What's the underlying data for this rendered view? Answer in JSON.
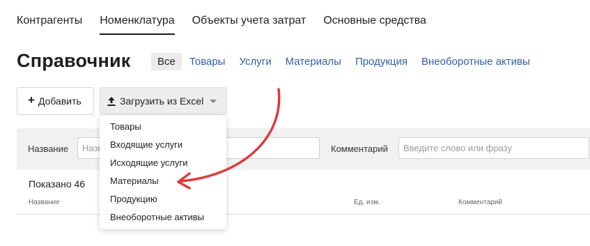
{
  "top_tabs": [
    {
      "label": "Контрагенты",
      "active": false
    },
    {
      "label": "Номенклатура",
      "active": true
    },
    {
      "label": "Объекты учета затрат",
      "active": false
    },
    {
      "label": "Основные средства",
      "active": false
    }
  ],
  "page_title": "Справочник",
  "filter_tabs": [
    {
      "label": "Все",
      "active": true
    },
    {
      "label": "Товары",
      "active": false
    },
    {
      "label": "Услуги",
      "active": false
    },
    {
      "label": "Материалы",
      "active": false
    },
    {
      "label": "Продукция",
      "active": false
    },
    {
      "label": "Внеоборотные активы",
      "active": false
    }
  ],
  "toolbar": {
    "add_label": "Добавить",
    "add_icon": "plus-icon",
    "excel_label": "Загрузить из Excel",
    "excel_icon": "upload-icon"
  },
  "filters": {
    "name_label": "Название",
    "name_placeholder": "Название",
    "comment_label": "Комментарий",
    "comment_placeholder": "Введите слово или фразу"
  },
  "shown_text": "Показано 46",
  "table": {
    "columns": [
      "Название",
      "Ед. изм.",
      "Комментарий"
    ]
  },
  "dropdown": {
    "items": [
      "Товары",
      "Входящие услуги",
      "Исходящие услуги",
      "Материалы",
      "Продукцию",
      "Внеоборотные активы"
    ]
  },
  "colors": {
    "link": "#2f5fa8",
    "annotation_arrow": "#e0393b",
    "filter_panel_bg": "#f1f1f1"
  }
}
